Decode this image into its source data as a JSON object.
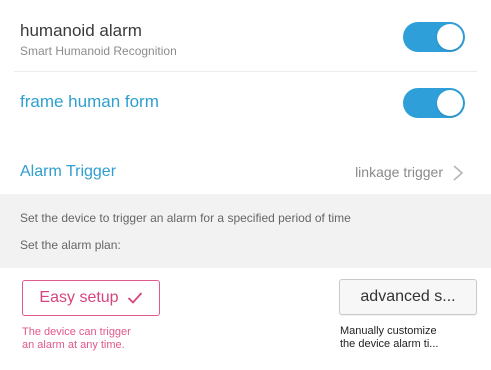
{
  "humanoid_alarm": {
    "title": "humanoid alarm",
    "subtitle": "Smart Humanoid Recognition",
    "enabled": true
  },
  "frame_human_form": {
    "title": "frame human form",
    "enabled": true
  },
  "alarm_trigger": {
    "title": "Alarm Trigger",
    "value": "linkage trigger",
    "icon": "chevron-right-icon"
  },
  "info": {
    "line1": "Set the device to trigger an alarm for a specified period of time",
    "line2": "Set the alarm plan:"
  },
  "plans": {
    "easy": {
      "label": "Easy setup",
      "selected": true,
      "icon": "checkmark-icon",
      "desc_line1": "The device can trigger",
      "desc_line2": "an alarm at any time."
    },
    "advanced": {
      "label": "advanced s...",
      "desc_line1": "Manually customize",
      "desc_line2": "the device alarm ti..."
    }
  },
  "colors": {
    "accent_blue": "#2f9fd9",
    "link_blue": "#2f9fcf",
    "pink": "#d4457f",
    "band_gray": "#f2f2f2"
  }
}
